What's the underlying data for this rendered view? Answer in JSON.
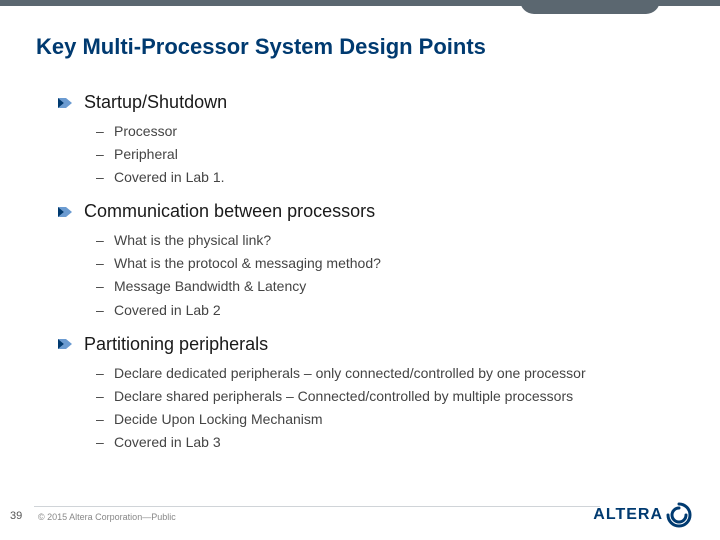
{
  "title": "Key Multi-Processor System Design Points",
  "sections": [
    {
      "heading": "Startup/Shutdown",
      "items": [
        "Processor",
        "Peripheral",
        "Covered in Lab 1."
      ]
    },
    {
      "heading": "Communication between processors",
      "items": [
        "What is the physical link?",
        "What is the protocol & messaging method?",
        "Message Bandwidth & Latency",
        "Covered in Lab 2"
      ]
    },
    {
      "heading": "Partitioning peripherals",
      "items": [
        "Declare dedicated peripherals – only connected/controlled by one processor",
        "Declare shared peripherals – Connected/controlled by multiple processors",
        "Decide Upon Locking Mechanism",
        "Covered in Lab 3"
      ]
    }
  ],
  "page_number": "39",
  "copyright": "© 2015 Altera Corporation—Public",
  "logo_text": "ALTERA",
  "colors": {
    "brand_blue": "#003a70",
    "bar_gray": "#5b6770"
  }
}
